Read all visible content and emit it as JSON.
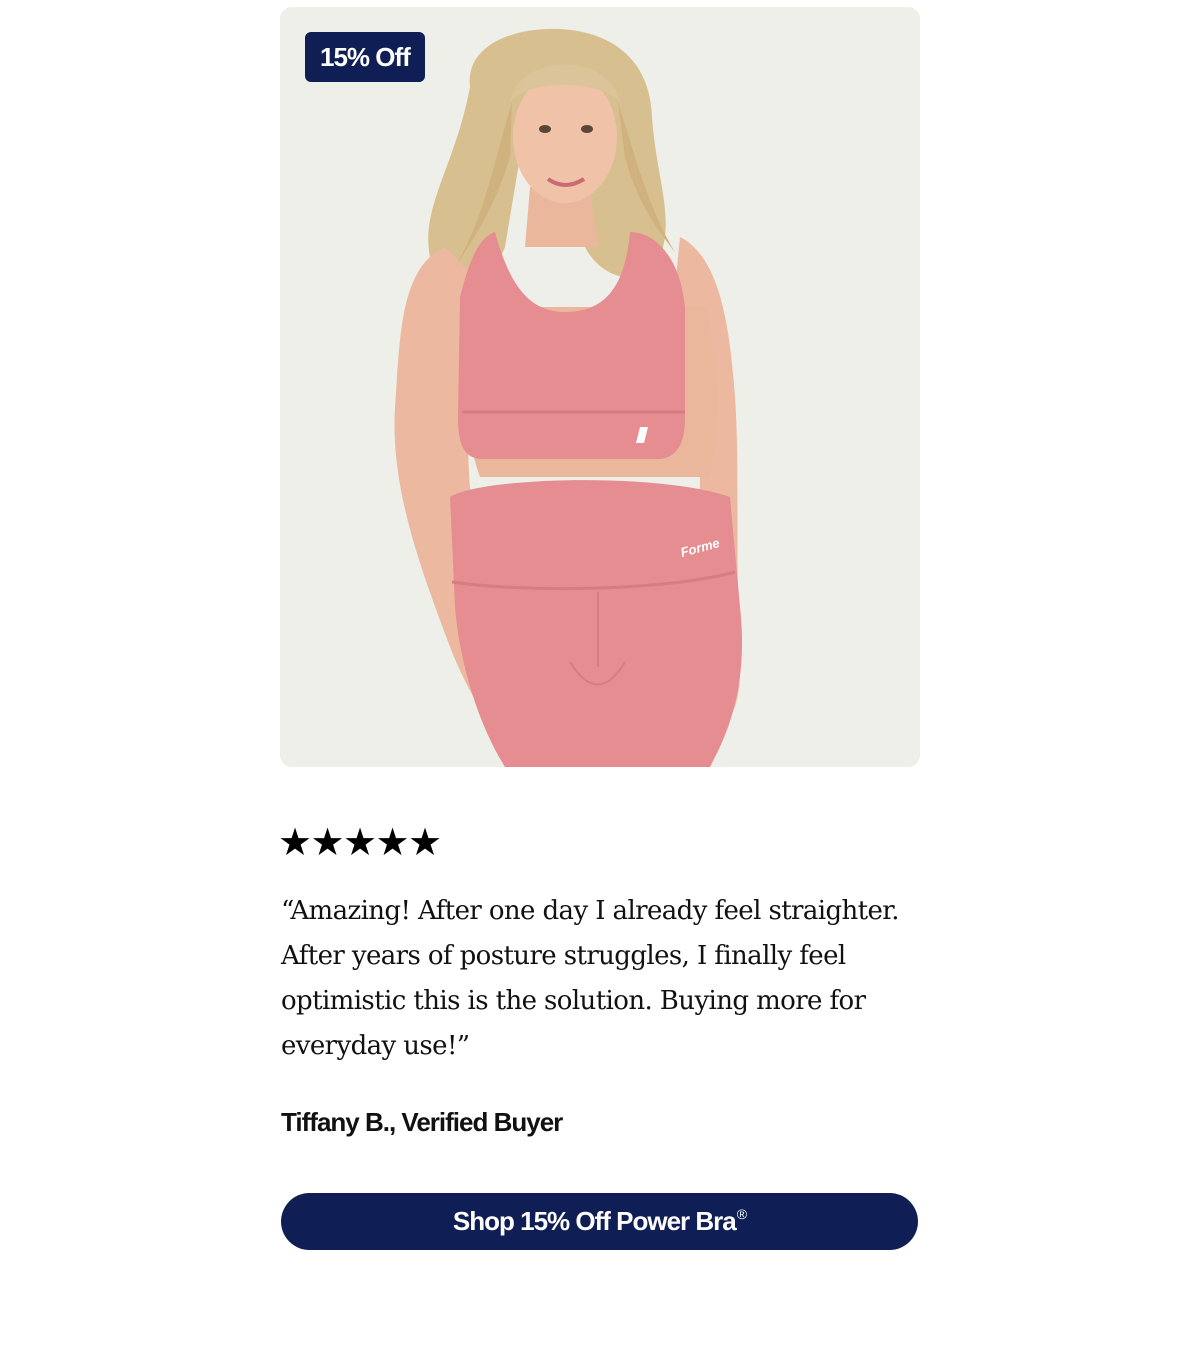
{
  "product": {
    "badge": "15% Off",
    "photo_description_icon": "model-photo",
    "leggings_logo": "Forme",
    "background_color": "#efefea",
    "apparel_color": "#e58d91"
  },
  "review": {
    "rating": 5,
    "rating_max": 5,
    "stars": [
      "★",
      "★",
      "★",
      "★",
      "★"
    ],
    "quote": "“Amazing! After one day I already feel straighter. After years of posture struggles, I finally feel optimistic this is the solution. Buying more for everyday use!”",
    "reviewer": "Tiffany B., Verified Buyer"
  },
  "cta": {
    "label": "Shop 15% Off Power Bra",
    "trademark": "®",
    "color": "#0f1f55"
  }
}
